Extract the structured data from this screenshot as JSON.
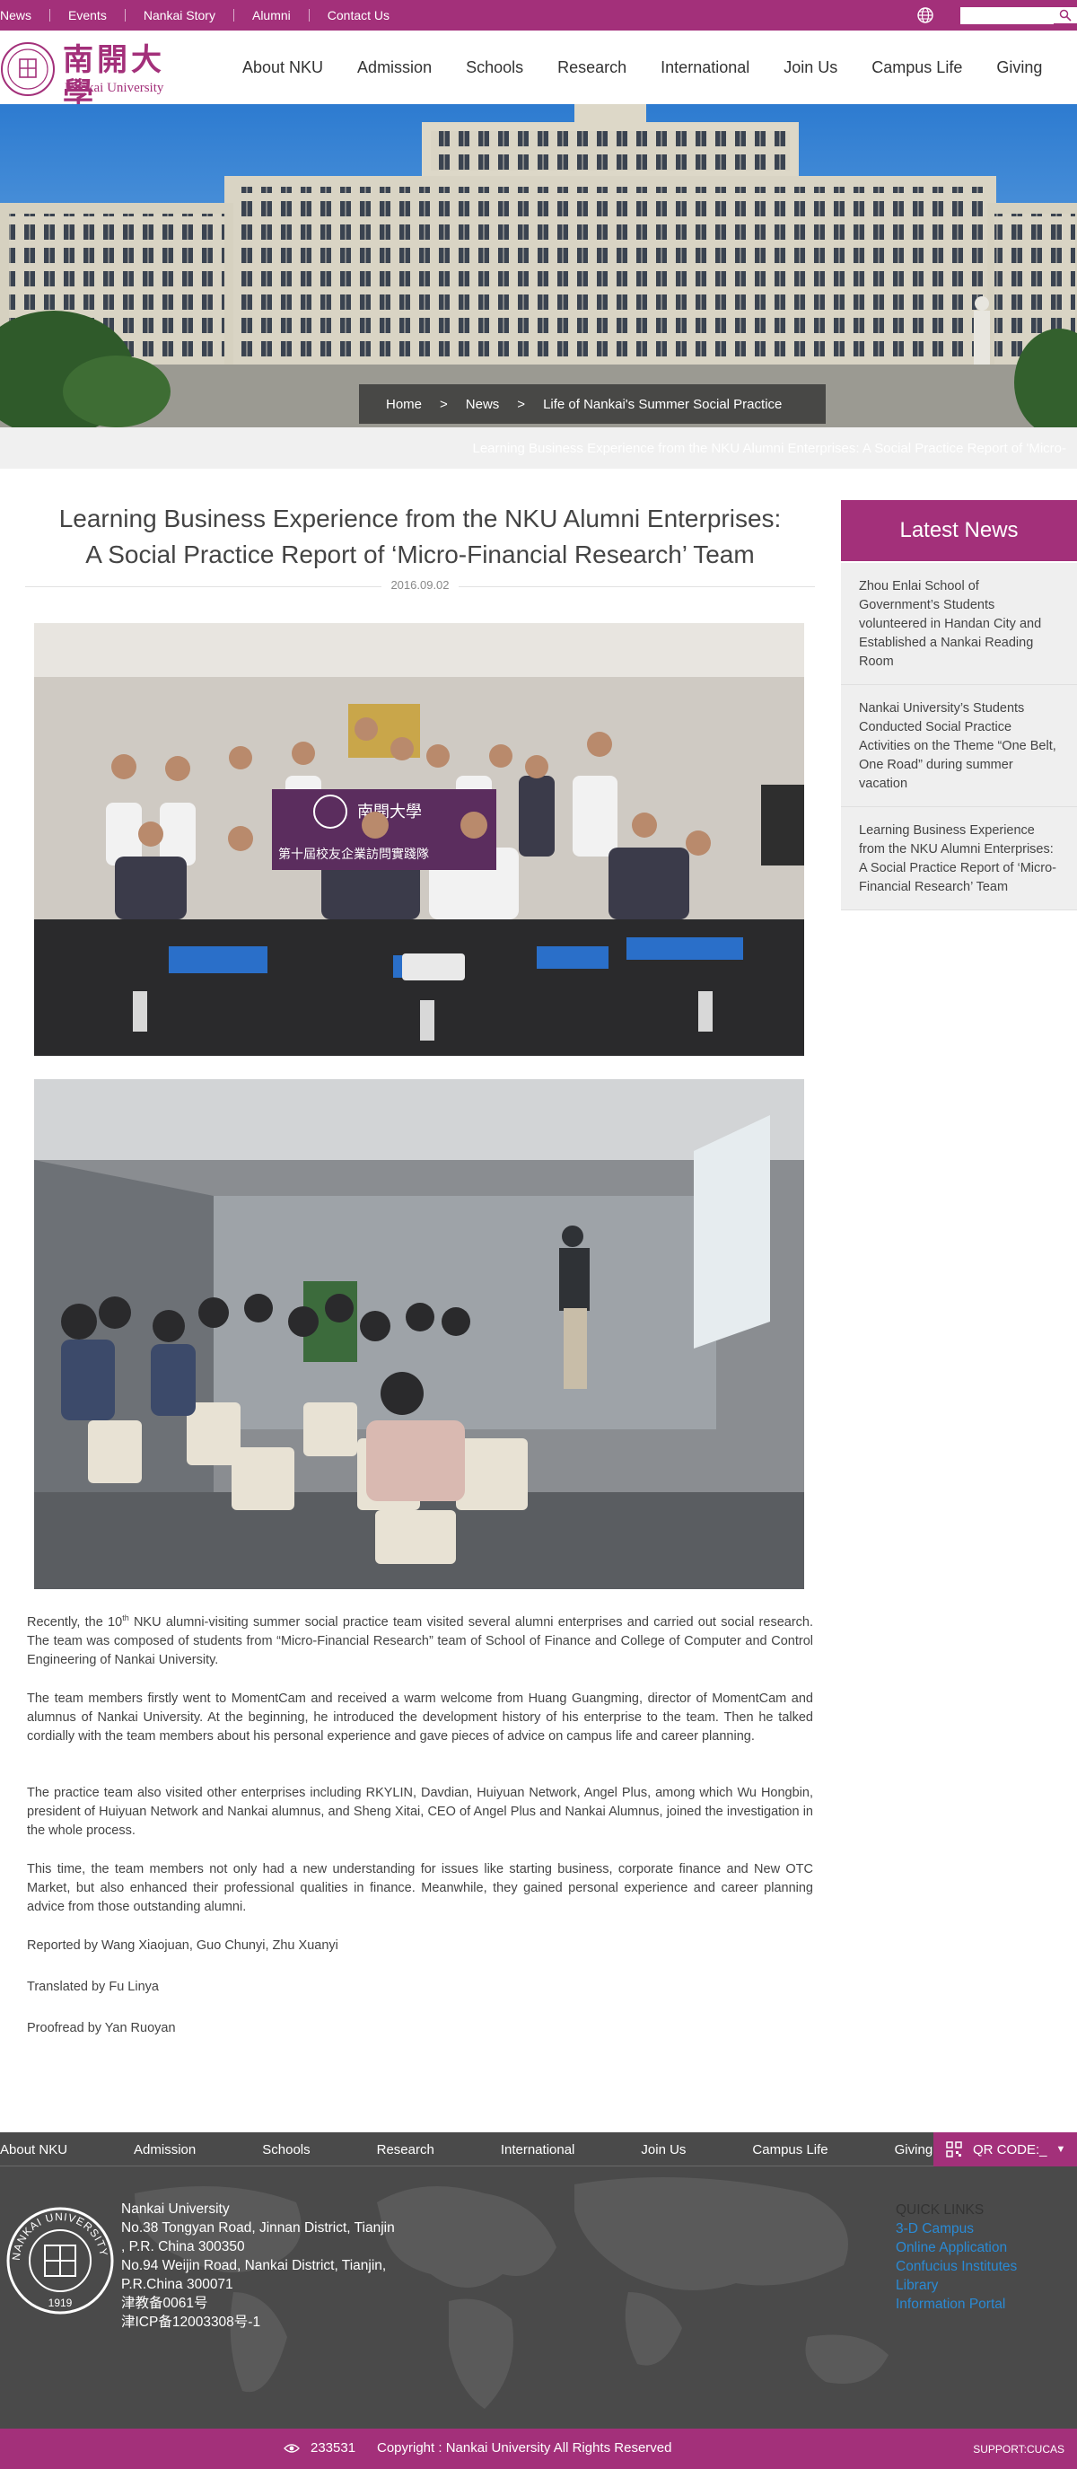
{
  "topbar": {
    "links": [
      "News",
      "Events",
      "Nankai Story",
      "Alumni",
      "Contact Us"
    ],
    "search_placeholder": ""
  },
  "logo": {
    "cn": "南開大學",
    "en": "Nankai University"
  },
  "nav": [
    "About NKU",
    "Admission",
    "Schools",
    "Research",
    "International",
    "Join Us",
    "Campus Life",
    "Giving"
  ],
  "breadcrumb": {
    "home": "Home",
    "sep": ">",
    "news": "News",
    "section": "Life of Nankai's Summer Social Practice"
  },
  "crumb_ghost": "Learning Business Experience from the NKU Alumni Enterprises: A Social Practice Report of 'Micro-",
  "article": {
    "title_line1": "Learning Business Experience from the NKU Alumni Enterprises:",
    "title_line2": "A Social Practice Report of ‘Micro-Financial Research’ Team",
    "date": "2016.09.02",
    "p1_a": "Recently, the 10",
    "p1_sup": "th",
    "p1_b": " NKU alumni-visiting summer social practice team visited several alumni enterprises and carried out social research. The team was composed of students from “Micro-Financial Research” team of School of Finance and College of Computer and Control Engineering of Nankai University.",
    "p2": "The team members firstly went to MomentCam and received a warm welcome from Huang Guangming, director of MomentCam and alumnus of Nankai University. At the beginning, he introduced the development history of his enterprise to the team. Then he talked cordially with the team members about his personal experience and gave pieces of advice on campus life and career planning.",
    "p3": "The practice team also visited other enterprises including RKYLIN, Davdian, Huiyuan Network, Angel Plus, among which Wu Hongbin, president of Huiyuan Network and Nankai alumnus, and Sheng Xitai, CEO of Angel Plus and Nankai Alumnus, joined the investigation in the whole process.",
    "p4": "This time, the team members not only had a new understanding for issues like starting business, corporate finance and New OTC Market, but also enhanced their professional qualities in finance. Meanwhile, they gained personal experience and career planning advice from those outstanding alumni.",
    "reported": "Reported by Wang Xiaojuan, Guo Chunyi, Zhu Xuanyi",
    "translated": "Translated by Fu Linya",
    "proofread": "Proofread by Yan Ruoyan",
    "banner_text": "第十屆校友企業訪問實踐隊"
  },
  "sidebar": {
    "heading": "Latest News",
    "items": [
      "Zhou Enlai School of Government’s Students volunteered in Handan City and Established a Nankai Reading Room",
      "Nankai University’s Students Conducted Social Practice Activities on the Theme “One Belt, One Road” during summer vacation",
      "Learning Business Experience from the NKU Alumni Enterprises: A Social Practice Report of ‘Micro-Financial Research’ Team"
    ]
  },
  "footer": {
    "nav": [
      "About NKU",
      "Admission",
      "Schools",
      "Research",
      "International",
      "Join Us",
      "Campus Life",
      "Giving"
    ],
    "qr_label": "QR CODE:_",
    "address": [
      "Nankai University",
      "No.38 Tongyan Road, Jinnan District, Tianjin",
      ", P.R. China 300350",
      "No.94 Weijin Road,  Nankai District, Tianjin,",
      "P.R.China  300071",
      "津教备0061号",
      "津ICP备12003308号-1"
    ],
    "quick_heading": "QUICK LINKS",
    "quick_links": [
      "3-D Campus",
      "Online Application",
      "Confucius Institutes",
      "Library",
      "Information Portal"
    ],
    "seal_text": "NANKAI UNIVERSITY",
    "seal_year": "1919"
  },
  "bottom": {
    "counter": "233531",
    "copyright": "Copyright : Nankai University All Rights Reserved",
    "support": "SUPPORT:CUCAS"
  },
  "colors": {
    "brand": "#a3307a",
    "footer": "#4a4a4a",
    "link": "#2a8ad4"
  }
}
